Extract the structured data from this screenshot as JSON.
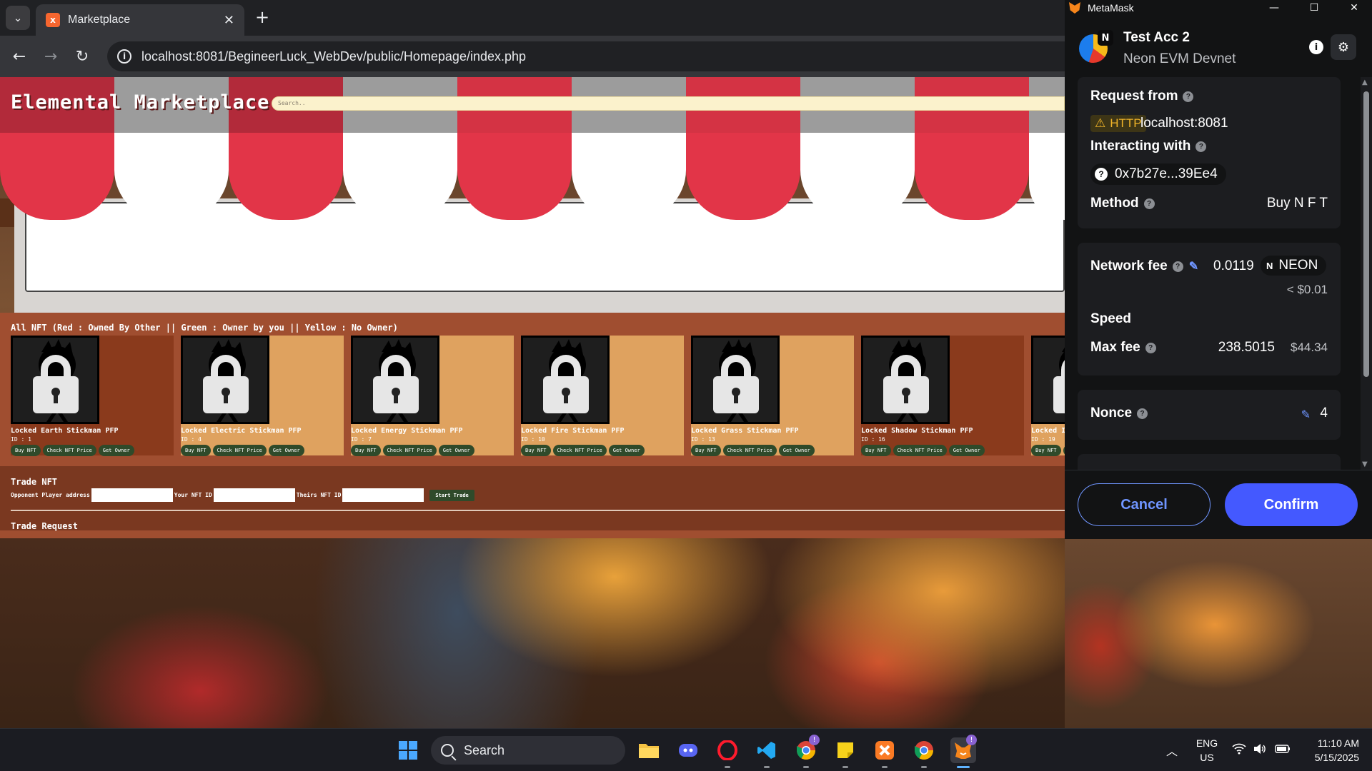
{
  "browser": {
    "tab_title": "Marketplace",
    "tab_close": "✕",
    "new_tab": "+",
    "url": "localhost:8081/BegineerLuck_WebDev/public/Homepage/index.php"
  },
  "page": {
    "site_title": "Elemental Marketplace",
    "search_placeholder": "Search..",
    "legend": "All NFT (Red : Owned By Other || Green : Owner by you || Yellow : No Owner)",
    "cards": [
      {
        "name": "Locked Earth Stickman PFP",
        "id": "ID : 1",
        "color": "#8a3a1c"
      },
      {
        "name": "Locked Electric Stickman PFP",
        "id": "ID : 4",
        "color": "#dfa25f"
      },
      {
        "name": "Locked Energy Stickman PFP",
        "id": "ID : 7",
        "color": "#dfa25f"
      },
      {
        "name": "Locked Fire Stickman PFP",
        "id": "ID : 10",
        "color": "#dfa25f"
      },
      {
        "name": "Locked Grass Stickman PFP",
        "id": "ID : 13",
        "color": "#dfa25f"
      },
      {
        "name": "Locked Shadow Stickman PFP",
        "id": "ID : 16",
        "color": "#8a3a1c"
      },
      {
        "name": "Locked I",
        "id": "ID : 19",
        "color": "#dfa25f"
      }
    ],
    "card_buttons": {
      "buy": "Buy NFT",
      "check": "Check NFT Price",
      "owner": "Get Owner"
    },
    "trade": {
      "title": "Trade NFT",
      "opponent_label": "Opponent Player address",
      "your_id_label": "Your NFT ID",
      "their_id_label": "Theirs NFT ID",
      "start_button": "Start Trade",
      "request_title": "Trade Request"
    }
  },
  "metamask": {
    "window_title": "MetaMask",
    "account_name": "Test Acc 2",
    "network_name": "Neon EVM Devnet",
    "network_badge": "N",
    "request_from_label": "Request from",
    "http_badge": "HTTP",
    "request_origin": "localhost:8081",
    "interacting_with_label": "Interacting with",
    "contract_address": "0x7b27e...39Ee4",
    "method_label": "Method",
    "method_value": "Buy N F T",
    "network_fee_label": "Network fee",
    "network_fee_value": "0.0119",
    "fee_token": "NEON",
    "fee_fiat": "< $0.01",
    "speed_label": "Speed",
    "max_fee_label": "Max fee",
    "max_fee_value": "238.5015",
    "max_fee_fiat": "$44.34",
    "nonce_label": "Nonce",
    "nonce_value": "4",
    "cancel_label": "Cancel",
    "confirm_label": "Confirm",
    "accent": "#4459ff"
  },
  "taskbar": {
    "search_label": "Search",
    "lang_top": "ENG",
    "lang_bottom": "US",
    "time": "11:10 AM",
    "date": "5/15/2025",
    "badge_chrome": "!",
    "badge_metamask": "!"
  }
}
